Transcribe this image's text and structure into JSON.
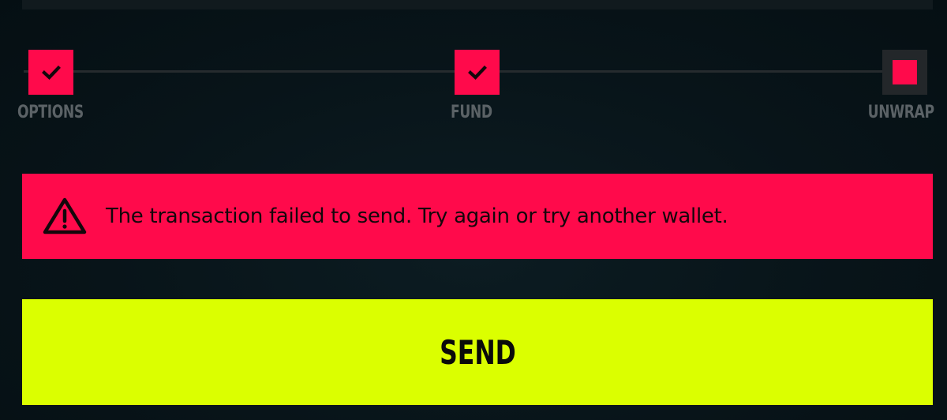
{
  "stepper": {
    "steps": [
      {
        "label": "OPTIONS",
        "state": "complete",
        "icon": "check-icon"
      },
      {
        "label": "FUND",
        "state": "complete",
        "icon": "check-icon"
      },
      {
        "label": "UNWRAP",
        "state": "current",
        "icon": "square-icon"
      }
    ]
  },
  "alert": {
    "icon": "warning-triangle-icon",
    "message": "The transaction failed to send. Try again or try another wallet."
  },
  "send_button": {
    "label": "SEND"
  },
  "colors": {
    "background": "#07151a",
    "accent_red": "#ff0a4b",
    "accent_lime": "#dbff00",
    "muted_label": "#5b6266",
    "inactive_box": "#23272a"
  }
}
